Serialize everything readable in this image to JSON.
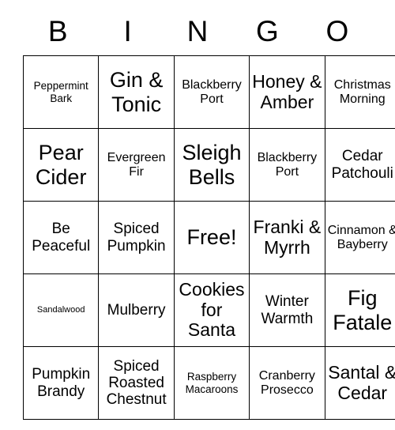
{
  "card": {
    "title": "BINGO",
    "header_letters": [
      "B",
      "I",
      "N",
      "G",
      "O"
    ],
    "free_space_label": "Free!",
    "colors": {
      "background": "#ffffff",
      "text": "#000000",
      "border": "#000000"
    },
    "rows": [
      [
        {
          "label": "Peppermint Bark",
          "size": "fs-s"
        },
        {
          "label": "Gin & Tonic",
          "size": "fs-xxl"
        },
        {
          "label": "Blackberry Port",
          "size": "fs-m"
        },
        {
          "label": "Honey & Amber",
          "size": "fs-xl"
        },
        {
          "label": "Christmas Morning",
          "size": "fs-m"
        }
      ],
      [
        {
          "label": "Pear Cider",
          "size": "fs-xxl"
        },
        {
          "label": "Evergreen Fir",
          "size": "fs-m"
        },
        {
          "label": "Sleigh Bells",
          "size": "fs-xxl"
        },
        {
          "label": "Blackberry Port",
          "size": "fs-m"
        },
        {
          "label": "Cedar Patchouli",
          "size": "fs-l"
        }
      ],
      [
        {
          "label": "Be Peaceful",
          "size": "fs-l"
        },
        {
          "label": "Spiced Pumpkin",
          "size": "fs-l"
        },
        {
          "label": "Free!",
          "size": "fs-xxl"
        },
        {
          "label": "Franki & Myrrh",
          "size": "fs-xl"
        },
        {
          "label": "Cinnamon & Bayberry",
          "size": "fs-m"
        }
      ],
      [
        {
          "label": "Sandalwood",
          "size": "fs-xs"
        },
        {
          "label": "Mulberry",
          "size": "fs-l"
        },
        {
          "label": "Cookies for Santa",
          "size": "fs-xl"
        },
        {
          "label": "Winter Warmth",
          "size": "fs-l"
        },
        {
          "label": "Fig Fatale",
          "size": "fs-xxl"
        }
      ],
      [
        {
          "label": "Pumpkin Brandy",
          "size": "fs-l"
        },
        {
          "label": "Spiced Roasted Chestnut",
          "size": "fs-l"
        },
        {
          "label": "Raspberry Macaroons",
          "size": "fs-s"
        },
        {
          "label": "Cranberry Prosecco",
          "size": "fs-m"
        },
        {
          "label": "Santal & Cedar",
          "size": "fs-xl"
        }
      ]
    ]
  }
}
